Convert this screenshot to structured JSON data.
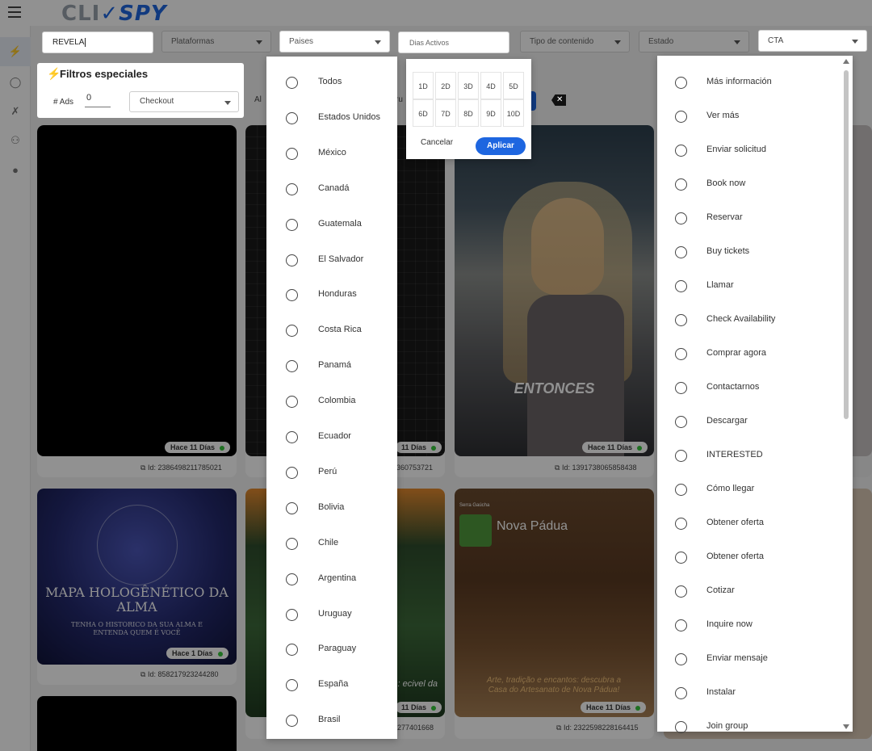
{
  "app": {
    "logo_left": "CLI",
    "logo_mark": "✓",
    "logo_right": "SPY"
  },
  "filters": {
    "search_value": "REVELA",
    "plataformas": "Plataformas",
    "paises": "Paises",
    "dias_activos": "Dias Activos",
    "tipo_contenido": "Tipo de contenido",
    "estado": "Estado",
    "cta": "CTA"
  },
  "special": {
    "title": "Filtros especiales",
    "ads_label": "# Ads",
    "ads_value": "0",
    "checkout": "Checkout"
  },
  "peek": {
    "al": "Al",
    "ru": "ru"
  },
  "cards": [
    {
      "badge": "Hace 11 Días",
      "id": "Id: 2386498211785021"
    },
    {
      "badge": "11 Días",
      "id": "360753721"
    },
    {
      "badge": "Hace 11 Días",
      "id": "Id: 1391738065858438",
      "overlay": "ENTONCES"
    },
    {
      "badge": "Hace 1 Días",
      "id": "Id: 858217923244280",
      "overlay_title": "MAPA HOLOGÊNÉTICO DA ALMA",
      "overlay_sub": "TENHA O HISTÓRICO DA SUA ALMA E ENTENDA QUEM É VOCÊ"
    },
    {
      "badge": "11 Días",
      "id": "277401668",
      "overlay_peek": "ncantos: ecivel da"
    },
    {
      "badge": "Hace 11 Días",
      "id": "Id: 2322598228164415",
      "overlay_title": "Nova Pádua",
      "overlay_tag": "Serra Gaúcha",
      "overlay_sub": "Arte, tradição e encantos: descubra a Casa do Artesanato de Nova Pádua!"
    }
  ],
  "paises_options": [
    "Todos",
    "Estados Unidos",
    "México",
    "Canadá",
    "Guatemala",
    "El Salvador",
    "Honduras",
    "Costa Rica",
    "Panamá",
    "Colombia",
    "Ecuador",
    "Perú",
    "Bolivia",
    "Chile",
    "Argentina",
    "Uruguay",
    "Paraguay",
    "España",
    "Brasil"
  ],
  "days": {
    "options": [
      "1D",
      "2D",
      "3D",
      "4D",
      "5D",
      "6D",
      "7D",
      "8D",
      "9D",
      "10D"
    ],
    "cancel": "Cancelar",
    "apply": "Aplicar"
  },
  "cta_options": [
    "Más información",
    "Ver más",
    "Enviar solicitud",
    "Book now",
    "Reservar",
    "Buy tickets",
    "Llamar",
    "Check Availability",
    "Comprar agora",
    "Contactarnos",
    "Descargar",
    "INTERESTED",
    "Cómo llegar",
    "Obtener oferta",
    "Obtener oferta",
    "Cotizar",
    "Inquire now",
    "Enviar mensaje",
    "Instalar",
    "Join group"
  ],
  "colors": {
    "accent": "#1e66e0",
    "active_dot": "#37c53d"
  }
}
